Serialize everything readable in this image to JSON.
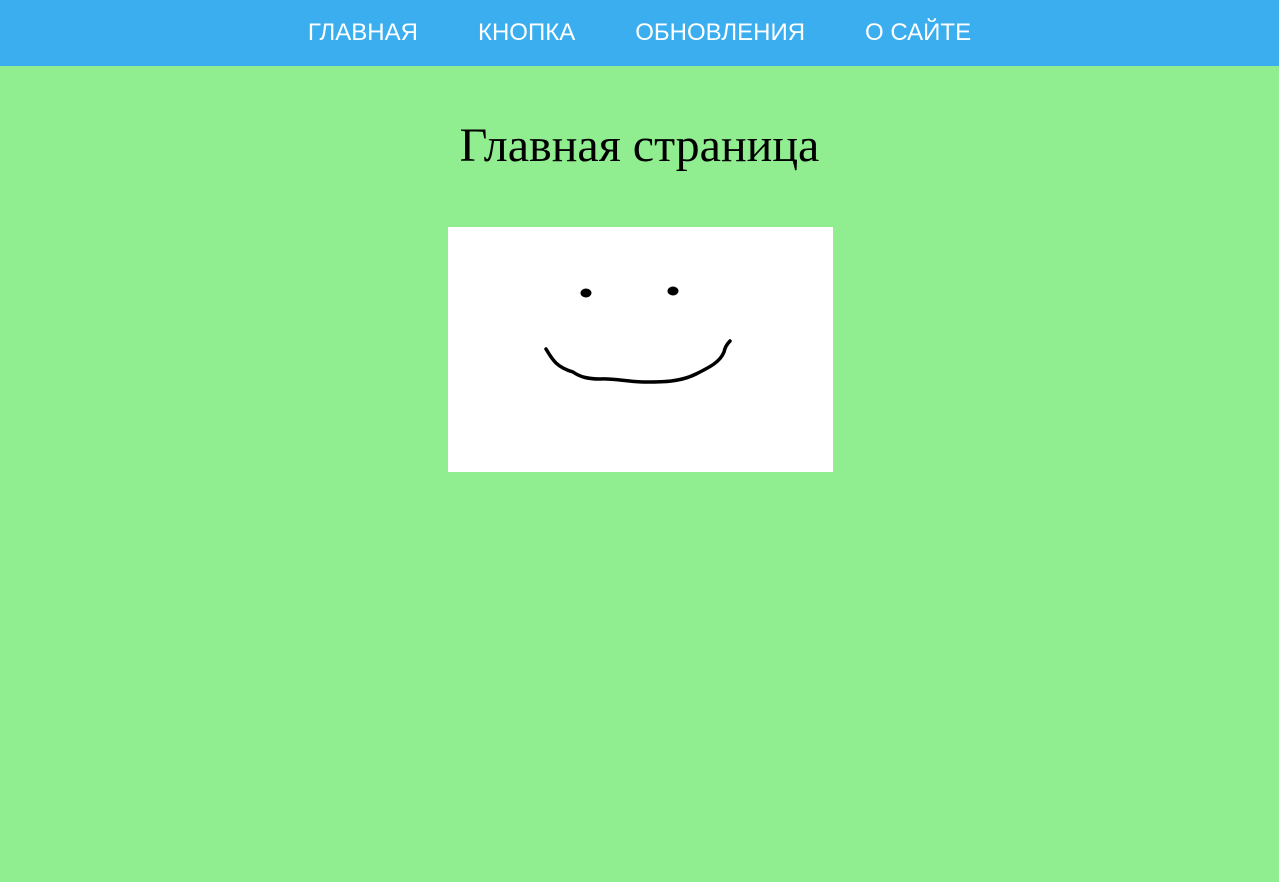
{
  "nav": {
    "items": [
      {
        "label": "ГЛАВНАЯ"
      },
      {
        "label": "КНОПКА"
      },
      {
        "label": "ОБНОВЛЕНИЯ"
      },
      {
        "label": "О САЙТЕ"
      }
    ]
  },
  "main": {
    "title": "Главная страница",
    "image": {
      "icon": "smiley-face-drawing"
    }
  },
  "colors": {
    "page_background": "#90ee90",
    "navbar_background": "#3baeef",
    "nav_text": "#ffffff",
    "title_text": "#000000"
  }
}
